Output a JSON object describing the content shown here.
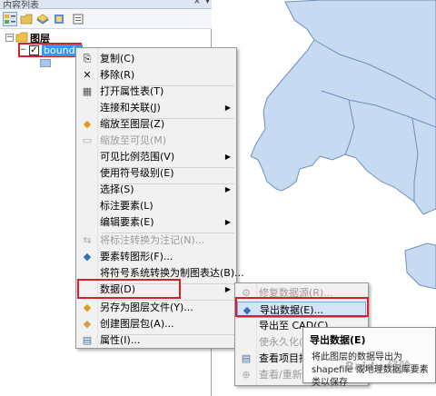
{
  "toc": {
    "title": "内容列表",
    "close_glyph": "×",
    "pin_glyph": "▾",
    "layers_label": "图层",
    "layer_name": "bounda",
    "check_glyph": "✓",
    "expander_minus": "−"
  },
  "menu": {
    "items": [
      {
        "label": "复制(C)",
        "icon": "copy-icon",
        "glyph": "⎘"
      },
      {
        "label": "移除(R)",
        "icon": "remove-icon",
        "glyph": "✕"
      },
      {
        "label": "打开属性表(T)",
        "icon": "table-icon",
        "glyph": "▦"
      },
      {
        "label": "连接和关联(J)",
        "icon": "",
        "glyph": ""
      },
      {
        "label": "缩放至图层(Z)",
        "icon": "zoom-layer-icon",
        "glyph": "◆"
      },
      {
        "label": "缩放至可见(M)",
        "icon": "zoom-visible-icon",
        "glyph": "▭"
      },
      {
        "label": "可见比例范围(V)",
        "icon": "",
        "glyph": ""
      },
      {
        "label": "使用符号级别(E)",
        "icon": "",
        "glyph": ""
      },
      {
        "label": "选择(S)",
        "icon": "",
        "glyph": ""
      },
      {
        "label": "标注要素(L)",
        "icon": "",
        "glyph": ""
      },
      {
        "label": "编辑要素(E)",
        "icon": "",
        "glyph": ""
      },
      {
        "label": "将标注转换为注记(N)...",
        "icon": "convert-labels-icon",
        "glyph": "⇆"
      },
      {
        "label": "要素转图形(F)...",
        "icon": "features-to-graphics-icon",
        "glyph": "◆"
      },
      {
        "label": "将符号系统转换为制图表达(B)...",
        "icon": "",
        "glyph": ""
      },
      {
        "label": "数据(D)",
        "icon": "",
        "glyph": ""
      },
      {
        "label": "另存为图层文件(Y)...",
        "icon": "save-layer-icon",
        "glyph": "◆"
      },
      {
        "label": "创建图层包(A)...",
        "icon": "layer-package-icon",
        "glyph": "◆"
      },
      {
        "label": "属性(I)...",
        "icon": "properties-icon",
        "glyph": "▤"
      }
    ],
    "arrow_glyph": "▶"
  },
  "submenu": {
    "items": [
      {
        "label": "修复数据源(R)...",
        "icon": "repair-icon",
        "glyph": "⚙"
      },
      {
        "label": "导出数据(E)...",
        "icon": "export-data-icon",
        "glyph": "◆"
      },
      {
        "label": "导出至 CAD(C)...",
        "icon": "",
        "glyph": ""
      },
      {
        "label": "使永久化(M)",
        "icon": "",
        "glyph": ""
      },
      {
        "label": "查看项目描述(I)...",
        "icon": "item-description-icon",
        "glyph": "▤"
      },
      {
        "label": "查看/重新匹配(E)...",
        "icon": "rematch-icon",
        "glyph": "⊕"
      }
    ]
  },
  "tooltip": {
    "title": "导出数据(E)",
    "body": "将此图层的数据导出为 shapefile 或地理数据库要素类以保存"
  },
  "watermark": "Baidu 经验",
  "colors": {
    "selection": "#3399ff",
    "highlight_box": "#d6202e",
    "menu_hover": "#d4e4f7",
    "map_fill": "#c6dbf2",
    "map_stroke": "#6c8fb8"
  }
}
